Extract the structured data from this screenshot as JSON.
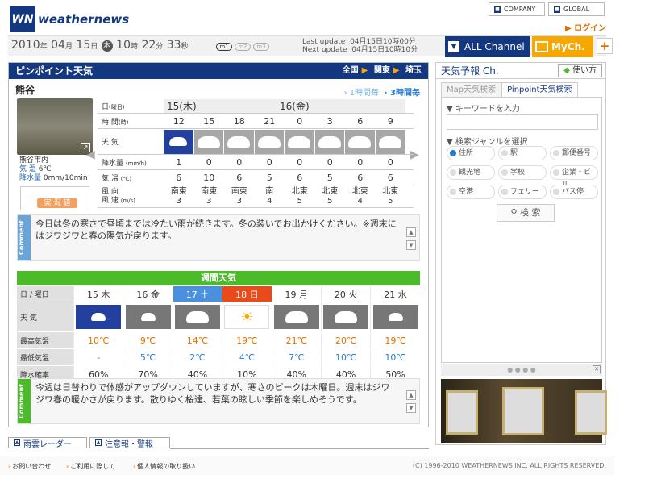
{
  "brand": {
    "logo": "WN",
    "name": "weathernews"
  },
  "toplinks": {
    "company": "COMPANY",
    "global": "GLOBAL"
  },
  "login": "ログイン",
  "datetime": {
    "year": "2010",
    "month": "04",
    "day": "15",
    "dow": "木",
    "hour": "10",
    "min": "22",
    "sec": "33",
    "y_unit": "年",
    "m_unit": "月",
    "d_unit": "日",
    "h_unit": "時",
    "mi_unit": "分",
    "s_unit": "秒"
  },
  "modes": [
    "m1",
    "m2",
    "m3"
  ],
  "last_update": {
    "label": "Last update",
    "value": "04月15日10時00分"
  },
  "next_update": {
    "label": "Next update",
    "value": "04月15日10時10分"
  },
  "nav": {
    "all_channel": "ALL Channel",
    "my_ch": "MyCh."
  },
  "pinpoint": {
    "title": "ピンポイント天気",
    "crumbs": [
      "全国",
      "関東",
      "埼玉"
    ],
    "city": "熊谷",
    "time_links": [
      "1時間毎",
      "3時間毎"
    ],
    "obs": {
      "place": "熊谷市内",
      "temp_label": "気 温",
      "temp": "6℃",
      "rain_label": "降水量",
      "rain": "0mm/10min",
      "live": "実 況 値"
    },
    "date_labels": [
      "15(木)",
      "16(金)"
    ],
    "row_labels": {
      "day": "日",
      "day_sub": "(曜日)",
      "time": "時 間",
      "time_sub": "(時)",
      "weather": "天 気",
      "precip": "降水量",
      "precip_sub": "(mm/h)",
      "temp": "気 温",
      "temp_sub": "(℃)",
      "wind": "風 向",
      "wind_speed": "風 速",
      "wind_sub": "(m/s)"
    },
    "hours": [
      "12",
      "15",
      "18",
      "21",
      "0",
      "3",
      "6",
      "9"
    ],
    "precip": [
      "1",
      "0",
      "0",
      "0",
      "0",
      "0",
      "0",
      "0"
    ],
    "temps": [
      "6",
      "10",
      "6",
      "5",
      "6",
      "5",
      "6",
      "6"
    ],
    "wind_dir": [
      "南東",
      "南東",
      "南東",
      "南",
      "北東",
      "北東",
      "北東",
      "北東"
    ],
    "wind_speed": [
      "3",
      "3",
      "3",
      "4",
      "5",
      "5",
      "4",
      "5"
    ],
    "comment_tag": "Comment",
    "comment": "今日は冬の寒さで昼頃までは冷たい雨が続きます。冬の装いでお出かけください。※週末にはジワジワと春の陽気が戻ります。"
  },
  "weekly": {
    "title": "週間天気",
    "labels": {
      "day": "日 / 曜日",
      "weather": "天 気",
      "hi": "最高気温",
      "lo": "最低気温",
      "pop": "降水確率"
    },
    "days": [
      "15 木",
      "16 金",
      "17 土",
      "18 日",
      "19 月",
      "20 火",
      "21 水"
    ],
    "hi": [
      "10℃",
      "9℃",
      "14℃",
      "19℃",
      "21℃",
      "20℃",
      "19℃"
    ],
    "lo": [
      "-",
      "5℃",
      "2℃",
      "4℃",
      "7℃",
      "10℃",
      "10℃"
    ],
    "pop": [
      "60%",
      "70%",
      "40%",
      "10%",
      "40%",
      "40%",
      "50%"
    ],
    "comment_tag": "Comment",
    "comment": "今週は日替わりで体感がアップダウンしていますが、寒さのピークは木曜日。週末はジワジワ春の暖かさが戻ります。散りゆく桜達、若葉の眩しい季節を楽しめそうです。"
  },
  "bottom_tabs": [
    "雨雲レーダー",
    "注意報・警報"
  ],
  "side": {
    "title": "天気予報 Ch.",
    "howto": "使い方",
    "tabs": [
      "Map天気検索",
      "Pinpoint天気検索"
    ],
    "kw_label": "キーワードを入力",
    "genre_label": "検索ジャンルを選択",
    "genres": [
      "住所",
      "駅",
      "郵便番号",
      "観光地",
      "学校",
      "企業・ビル",
      "空港",
      "フェリー",
      "バス停"
    ],
    "search": "検 索"
  },
  "footer": {
    "links": [
      "お問い合わせ",
      "ご利用に際して",
      "個人情報の取り扱い"
    ],
    "copyright": "(C) 1996-2010 WEATHERNEWS INC. ALL RIGHTS RESERVED."
  }
}
